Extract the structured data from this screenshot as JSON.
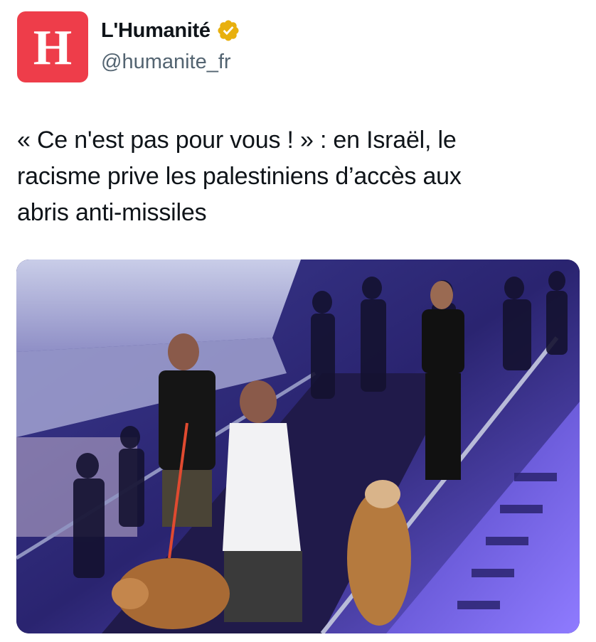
{
  "account": {
    "avatar_letter": "H",
    "display_name": "L'Humanité",
    "handle": "@humanite_fr",
    "verified_icon": "verified-badge-icon",
    "brand_color": "#ee3d4a",
    "badge_color": "#e8b00e"
  },
  "tweet": {
    "text_line_1": "« Ce n'est pas pour vous ! » : en Israël, le",
    "text_line_2": "racisme prive les palestiniens d’accès aux",
    "text_line_3": "abris anti-missiles"
  }
}
